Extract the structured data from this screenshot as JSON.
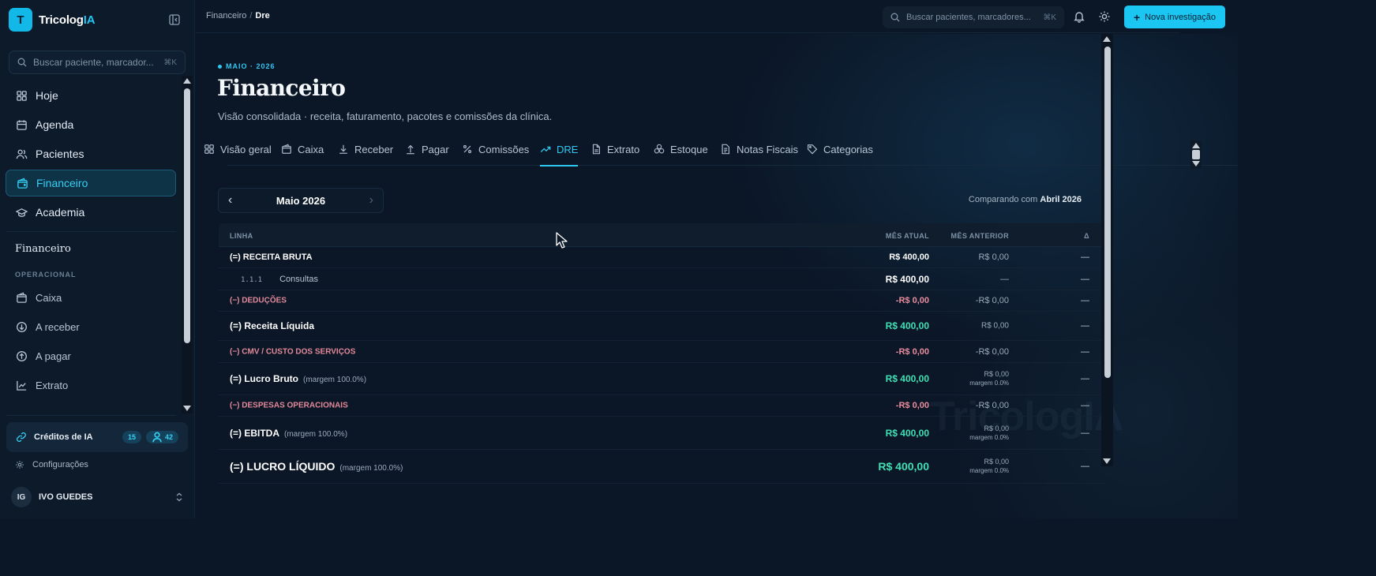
{
  "brand": {
    "name": "Tricolog",
    "name_suffix": "IA",
    "logo_letter": "T"
  },
  "sidebar": {
    "search_placeholder": "Buscar paciente, marcador...",
    "search_shortcut": "⌘K",
    "nav": [
      {
        "label": "Hoje",
        "icon": "grid-icon"
      },
      {
        "label": "Agenda",
        "icon": "calendar-icon"
      },
      {
        "label": "Pacientes",
        "icon": "users-icon"
      },
      {
        "label": "Financeiro",
        "icon": "wallet-icon",
        "active": true
      },
      {
        "label": "Academia",
        "icon": "graduation-cap-icon"
      }
    ],
    "section_title": "Financeiro",
    "section_sub": "OPERACIONAL",
    "section_items": [
      {
        "label": "Caixa",
        "icon": "wallet-icon"
      },
      {
        "label": "A receber",
        "icon": "arrow-down-circle-icon"
      },
      {
        "label": "A pagar",
        "icon": "arrow-up-circle-icon"
      },
      {
        "label": "Extrato",
        "icon": "chart-line-icon"
      }
    ],
    "credits": {
      "label": "Créditos de IA",
      "count_a": "15",
      "count_b": "42"
    },
    "settings_label": "Configurações",
    "user": {
      "initials": "IG",
      "name": "IVO GUEDES"
    }
  },
  "topbar": {
    "breadcrumb": [
      "Financeiro",
      "Dre"
    ],
    "search_placeholder": "Buscar pacientes, marcadores...",
    "search_shortcut": "⌘K",
    "new_button": "Nova investigação"
  },
  "page": {
    "period_tag": "MAIO · 2026",
    "title": "Financeiro",
    "subtitle": "Visão consolidada · receita, faturamento, pacotes e comissões da clínica."
  },
  "tabs": [
    {
      "label": "Visão geral",
      "icon": "grid-icon"
    },
    {
      "label": "Caixa",
      "icon": "wallet-icon"
    },
    {
      "label": "Receber",
      "icon": "download-icon"
    },
    {
      "label": "Pagar",
      "icon": "upload-icon"
    },
    {
      "label": "Comissões",
      "icon": "percent-icon"
    },
    {
      "label": "DRE",
      "icon": "trending-up-icon",
      "active": true
    },
    {
      "label": "Extrato",
      "icon": "file-icon"
    },
    {
      "label": "Estoque",
      "icon": "boxes-icon"
    },
    {
      "label": "Notas Fiscais",
      "icon": "receipt-icon"
    },
    {
      "label": "Categorias",
      "icon": "tag-icon"
    }
  ],
  "period_selector": {
    "label": "Maio 2026"
  },
  "compare": {
    "prefix": "Comparando com",
    "period": "Abril 2026"
  },
  "table": {
    "headers": {
      "line": "LINHA",
      "current": "MÊS ATUAL",
      "previous": "MÊS ANTERIOR",
      "delta": "Δ"
    },
    "rows": [
      {
        "type": "res-top",
        "label": "(=) RECEITA BRUTA",
        "current": "R$ 400,00",
        "previous": "R$ 0,00",
        "delta": "—"
      },
      {
        "type": "sub",
        "code": "1.1.1",
        "label": "Consultas",
        "current": "R$ 400,00",
        "previous": "—",
        "delta": "—"
      },
      {
        "type": "ded",
        "label": "(−) DEDUÇÕES",
        "current": "-R$ 0,00",
        "previous": "-R$ 0,00",
        "delta": "—"
      },
      {
        "type": "res",
        "label": "(=) Receita Líquida",
        "current": "R$ 400,00",
        "previous": "R$ 0,00",
        "delta": "—"
      },
      {
        "type": "ded",
        "label": "(−) CMV / CUSTO DOS SERVIÇOS",
        "current": "-R$ 0,00",
        "previous": "-R$ 0,00",
        "delta": "—"
      },
      {
        "type": "res",
        "label": "(=) Lucro Bruto",
        "margin": "(margem 100.0%)",
        "current": "R$ 400,00",
        "previous": "R$ 0,00",
        "previous_margin": "margem 0.0%",
        "delta": "—"
      },
      {
        "type": "ded",
        "label": "(−) DESPESAS OPERACIONAIS",
        "current": "-R$ 0,00",
        "previous": "-R$ 0,00",
        "delta": "—"
      },
      {
        "type": "res",
        "label": "(=) EBITDA",
        "margin": "(margem 100.0%)",
        "current": "R$ 400,00",
        "previous": "R$ 0,00",
        "previous_margin": "margem 0.0%",
        "delta": "—"
      },
      {
        "type": "big",
        "label": "(=) LUCRO LÍQUIDO",
        "margin": "(margem 100.0%)",
        "current": "R$ 400,00",
        "previous": "R$ 0,00",
        "previous_margin": "margem 0.0%",
        "delta": "—"
      }
    ]
  },
  "watermark": "TricologIA",
  "colors": {
    "accent": "#1cc6f2",
    "positive": "#3fe0b5",
    "negative": "#ea8d9e",
    "background": "#0b1626"
  }
}
